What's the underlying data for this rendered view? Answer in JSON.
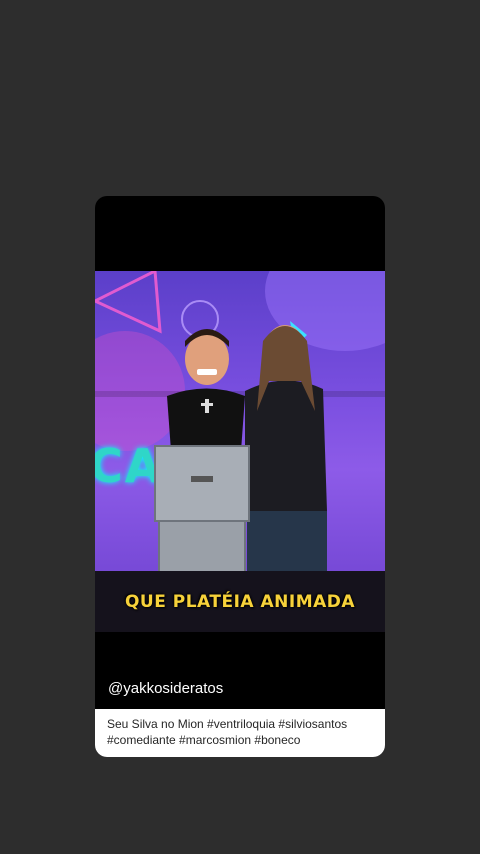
{
  "story": {
    "caption_overlay": "QUE PLATÉIA ANIMADA",
    "username": "@yakkosideratos",
    "description": "Seu Silva no Mion #ventriloquia #silviosantos #comediante #marcosmion #boneco",
    "stage_letters": "CA   IE"
  },
  "colors": {
    "background": "#2d2d2d",
    "caption": "#f7d23a",
    "stage_purple": "#7a4fe0"
  }
}
